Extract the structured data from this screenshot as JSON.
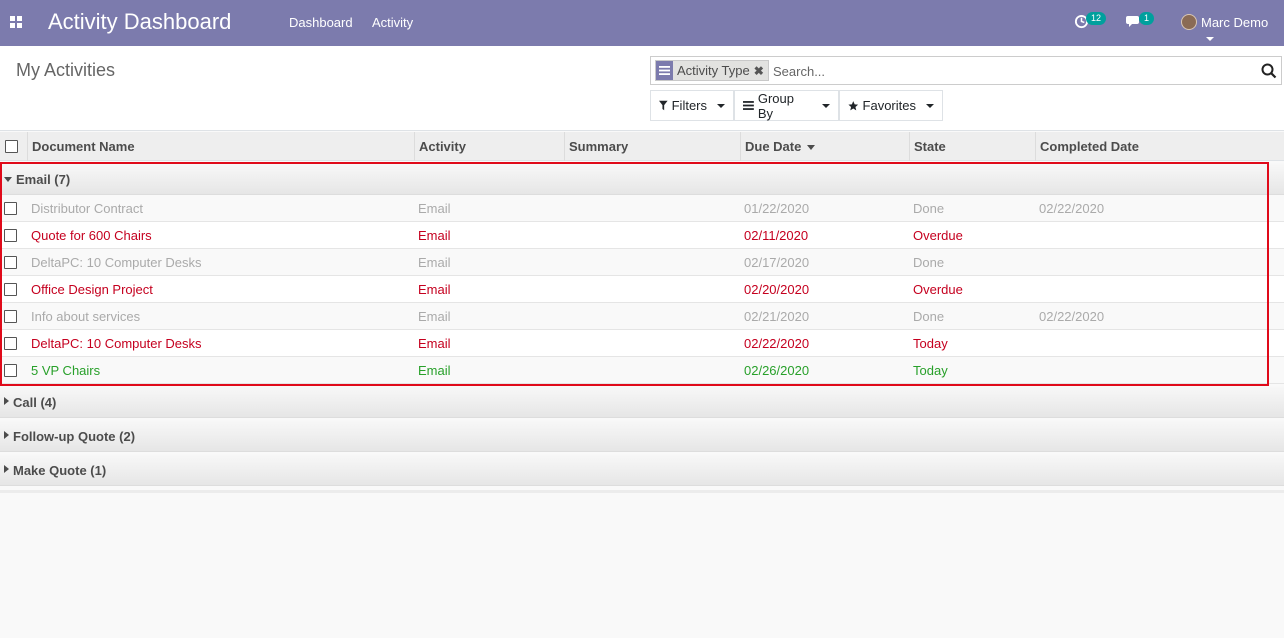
{
  "navbar": {
    "brand": "Activity Dashboard",
    "menu": [
      "Dashboard",
      "Activity"
    ],
    "activity_count": "12",
    "message_count": "1",
    "user_name": "Marc Demo",
    "color": "#7c7bad"
  },
  "control_panel": {
    "title": "My Activities",
    "facet_label": "Activity Type",
    "search_placeholder": "Search...",
    "filters_label": "Filters",
    "group_by_label": "Group By",
    "favorites_label": "Favorites"
  },
  "columns": [
    "Document Name",
    "Activity",
    "Summary",
    "Due Date",
    "State",
    "Completed Date"
  ],
  "groups": [
    {
      "label": "Email (7)",
      "expanded": true,
      "rows": [
        {
          "document": "Distributor Contract",
          "activity": "Email",
          "summary": "",
          "due_date": "01/22/2020",
          "state": "Done",
          "completed": "02/22/2020",
          "status": "done"
        },
        {
          "document": "Quote for 600 Chairs",
          "activity": "Email",
          "summary": "",
          "due_date": "02/11/2020",
          "state": "Overdue",
          "completed": "",
          "status": "overdue"
        },
        {
          "document": "DeltaPC: 10 Computer Desks",
          "activity": "Email",
          "summary": "",
          "due_date": "02/17/2020",
          "state": "Done",
          "completed": "",
          "status": "done"
        },
        {
          "document": "Office Design Project",
          "activity": "Email",
          "summary": "",
          "due_date": "02/20/2020",
          "state": "Overdue",
          "completed": "",
          "status": "overdue"
        },
        {
          "document": "Info about services",
          "activity": "Email",
          "summary": "",
          "due_date": "02/21/2020",
          "state": "Done",
          "completed": "02/22/2020",
          "status": "done"
        },
        {
          "document": "DeltaPC: 10 Computer Desks",
          "activity": "Email",
          "summary": "",
          "due_date": "02/22/2020",
          "state": "Today",
          "completed": "",
          "status": "overdue"
        },
        {
          "document": "5 VP Chairs",
          "activity": "Email",
          "summary": "",
          "due_date": "02/26/2020",
          "state": "Today",
          "completed": "",
          "status": "planned"
        }
      ]
    },
    {
      "label": "Call (4)",
      "expanded": false,
      "rows": []
    },
    {
      "label": "Follow-up Quote (2)",
      "expanded": false,
      "rows": []
    },
    {
      "label": "Make Quote (1)",
      "expanded": false,
      "rows": []
    }
  ],
  "status_colors": {
    "done": "#aaaaaa",
    "overdue": "#c5001f",
    "planned": "#28a02a"
  }
}
